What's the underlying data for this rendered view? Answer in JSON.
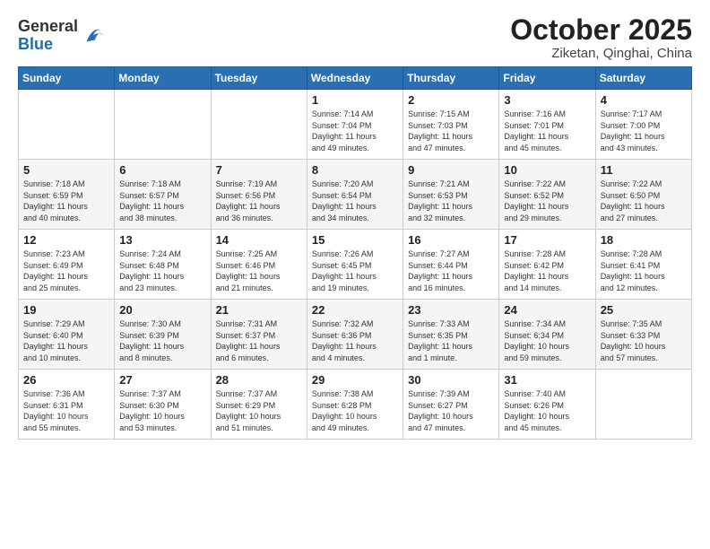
{
  "header": {
    "logo_line1": "General",
    "logo_line2": "Blue",
    "title": "October 2025",
    "subtitle": "Ziketan, Qinghai, China"
  },
  "weekdays": [
    "Sunday",
    "Monday",
    "Tuesday",
    "Wednesday",
    "Thursday",
    "Friday",
    "Saturday"
  ],
  "weeks": [
    [
      {
        "day": "",
        "info": ""
      },
      {
        "day": "",
        "info": ""
      },
      {
        "day": "",
        "info": ""
      },
      {
        "day": "1",
        "info": "Sunrise: 7:14 AM\nSunset: 7:04 PM\nDaylight: 11 hours\nand 49 minutes."
      },
      {
        "day": "2",
        "info": "Sunrise: 7:15 AM\nSunset: 7:03 PM\nDaylight: 11 hours\nand 47 minutes."
      },
      {
        "day": "3",
        "info": "Sunrise: 7:16 AM\nSunset: 7:01 PM\nDaylight: 11 hours\nand 45 minutes."
      },
      {
        "day": "4",
        "info": "Sunrise: 7:17 AM\nSunset: 7:00 PM\nDaylight: 11 hours\nand 43 minutes."
      }
    ],
    [
      {
        "day": "5",
        "info": "Sunrise: 7:18 AM\nSunset: 6:59 PM\nDaylight: 11 hours\nand 40 minutes."
      },
      {
        "day": "6",
        "info": "Sunrise: 7:18 AM\nSunset: 6:57 PM\nDaylight: 11 hours\nand 38 minutes."
      },
      {
        "day": "7",
        "info": "Sunrise: 7:19 AM\nSunset: 6:56 PM\nDaylight: 11 hours\nand 36 minutes."
      },
      {
        "day": "8",
        "info": "Sunrise: 7:20 AM\nSunset: 6:54 PM\nDaylight: 11 hours\nand 34 minutes."
      },
      {
        "day": "9",
        "info": "Sunrise: 7:21 AM\nSunset: 6:53 PM\nDaylight: 11 hours\nand 32 minutes."
      },
      {
        "day": "10",
        "info": "Sunrise: 7:22 AM\nSunset: 6:52 PM\nDaylight: 11 hours\nand 29 minutes."
      },
      {
        "day": "11",
        "info": "Sunrise: 7:22 AM\nSunset: 6:50 PM\nDaylight: 11 hours\nand 27 minutes."
      }
    ],
    [
      {
        "day": "12",
        "info": "Sunrise: 7:23 AM\nSunset: 6:49 PM\nDaylight: 11 hours\nand 25 minutes."
      },
      {
        "day": "13",
        "info": "Sunrise: 7:24 AM\nSunset: 6:48 PM\nDaylight: 11 hours\nand 23 minutes."
      },
      {
        "day": "14",
        "info": "Sunrise: 7:25 AM\nSunset: 6:46 PM\nDaylight: 11 hours\nand 21 minutes."
      },
      {
        "day": "15",
        "info": "Sunrise: 7:26 AM\nSunset: 6:45 PM\nDaylight: 11 hours\nand 19 minutes."
      },
      {
        "day": "16",
        "info": "Sunrise: 7:27 AM\nSunset: 6:44 PM\nDaylight: 11 hours\nand 16 minutes."
      },
      {
        "day": "17",
        "info": "Sunrise: 7:28 AM\nSunset: 6:42 PM\nDaylight: 11 hours\nand 14 minutes."
      },
      {
        "day": "18",
        "info": "Sunrise: 7:28 AM\nSunset: 6:41 PM\nDaylight: 11 hours\nand 12 minutes."
      }
    ],
    [
      {
        "day": "19",
        "info": "Sunrise: 7:29 AM\nSunset: 6:40 PM\nDaylight: 11 hours\nand 10 minutes."
      },
      {
        "day": "20",
        "info": "Sunrise: 7:30 AM\nSunset: 6:39 PM\nDaylight: 11 hours\nand 8 minutes."
      },
      {
        "day": "21",
        "info": "Sunrise: 7:31 AM\nSunset: 6:37 PM\nDaylight: 11 hours\nand 6 minutes."
      },
      {
        "day": "22",
        "info": "Sunrise: 7:32 AM\nSunset: 6:36 PM\nDaylight: 11 hours\nand 4 minutes."
      },
      {
        "day": "23",
        "info": "Sunrise: 7:33 AM\nSunset: 6:35 PM\nDaylight: 11 hours\nand 1 minute."
      },
      {
        "day": "24",
        "info": "Sunrise: 7:34 AM\nSunset: 6:34 PM\nDaylight: 10 hours\nand 59 minutes."
      },
      {
        "day": "25",
        "info": "Sunrise: 7:35 AM\nSunset: 6:33 PM\nDaylight: 10 hours\nand 57 minutes."
      }
    ],
    [
      {
        "day": "26",
        "info": "Sunrise: 7:36 AM\nSunset: 6:31 PM\nDaylight: 10 hours\nand 55 minutes."
      },
      {
        "day": "27",
        "info": "Sunrise: 7:37 AM\nSunset: 6:30 PM\nDaylight: 10 hours\nand 53 minutes."
      },
      {
        "day": "28",
        "info": "Sunrise: 7:37 AM\nSunset: 6:29 PM\nDaylight: 10 hours\nand 51 minutes."
      },
      {
        "day": "29",
        "info": "Sunrise: 7:38 AM\nSunset: 6:28 PM\nDaylight: 10 hours\nand 49 minutes."
      },
      {
        "day": "30",
        "info": "Sunrise: 7:39 AM\nSunset: 6:27 PM\nDaylight: 10 hours\nand 47 minutes."
      },
      {
        "day": "31",
        "info": "Sunrise: 7:40 AM\nSunset: 6:26 PM\nDaylight: 10 hours\nand 45 minutes."
      },
      {
        "day": "",
        "info": ""
      }
    ]
  ]
}
